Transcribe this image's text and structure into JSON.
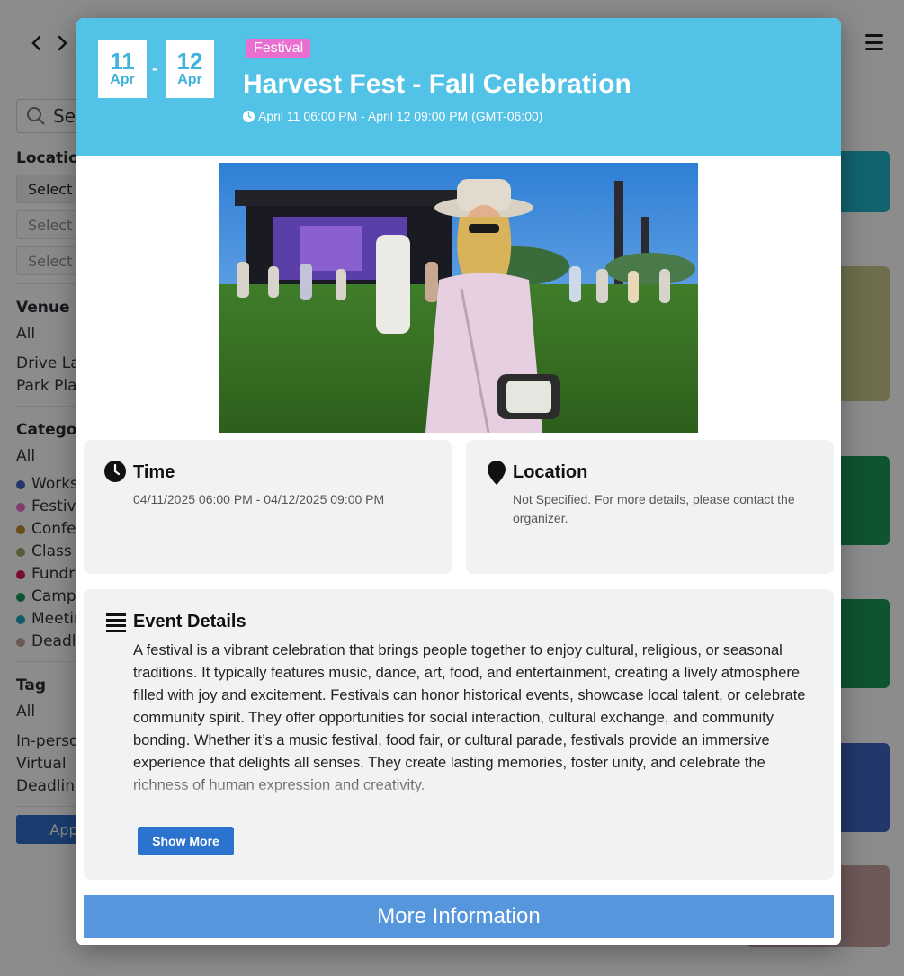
{
  "background": {
    "search_placeholder": "Sea",
    "location": {
      "heading": "Location",
      "select_first": "Select",
      "select_second": "Select",
      "select_third": "Select"
    },
    "venue": {
      "heading": "Venue",
      "items": [
        "All",
        "Drive La",
        "Park Pla"
      ]
    },
    "category": {
      "heading": "Categor",
      "all": "All",
      "items": [
        {
          "label": "Works",
          "color": "#3f67c2"
        },
        {
          "label": "Festiv",
          "color": "#e86fd0"
        },
        {
          "label": "Confe",
          "color": "#c28a2f"
        },
        {
          "label": "Class",
          "color": "#a5a56a"
        },
        {
          "label": "Fundr",
          "color": "#d61a55"
        },
        {
          "label": "Camp",
          "color": "#1a9a55"
        },
        {
          "label": "Meetin",
          "color": "#1fa3b8"
        },
        {
          "label": "Deadl",
          "color": "#c9a2a2"
        }
      ]
    },
    "tag": {
      "heading": "Tag",
      "items": [
        "All",
        "In-perso",
        "Virtual",
        "Deadline"
      ]
    },
    "apply_label": "Apply",
    "cards": [
      {
        "color": "#1fb5c8"
      },
      {
        "color": "#c8c88a"
      },
      {
        "color": "#1a9a55"
      },
      {
        "color": "#1a9a55"
      },
      {
        "color": "#3f67c2"
      },
      {
        "color": "#c9a2a2"
      }
    ]
  },
  "modal": {
    "start_day": "11",
    "start_month": "Apr",
    "separator": "-",
    "end_day": "12",
    "end_month": "Apr",
    "category_tag": "Festival",
    "title": "Harvest Fest - Fall Celebration",
    "date_range": "April 11 06:00 PM - April 12 09:00 PM (GMT-06:00)",
    "header_color": "#52c2e6",
    "time_panel": {
      "title": "Time",
      "value": "04/11/2025 06:00 PM - 04/12/2025 09:00 PM"
    },
    "location_panel": {
      "title": "Location",
      "value": "Not Specified. For more details, please contact the organizer."
    },
    "details_panel": {
      "title": "Event Details",
      "text": "A festival is a vibrant celebration that brings people together to enjoy cultural, religious, or seasonal traditions. It typically features music, dance, art, food, and entertainment, creating a lively atmosphere filled with joy and excitement. Festivals can honor historical events, showcase local talent, or celebrate community spirit. They offer opportunities for social interaction, cultural exchange, and community bonding. Whether it’s a music festival, food fair, or cultural parade, festivals provide an immersive experience that delights all senses. They create lasting memories, foster unity, and celebrate the richness of human expression and creativity."
    },
    "show_more_label": "Show More",
    "more_info_label": "More Information"
  }
}
